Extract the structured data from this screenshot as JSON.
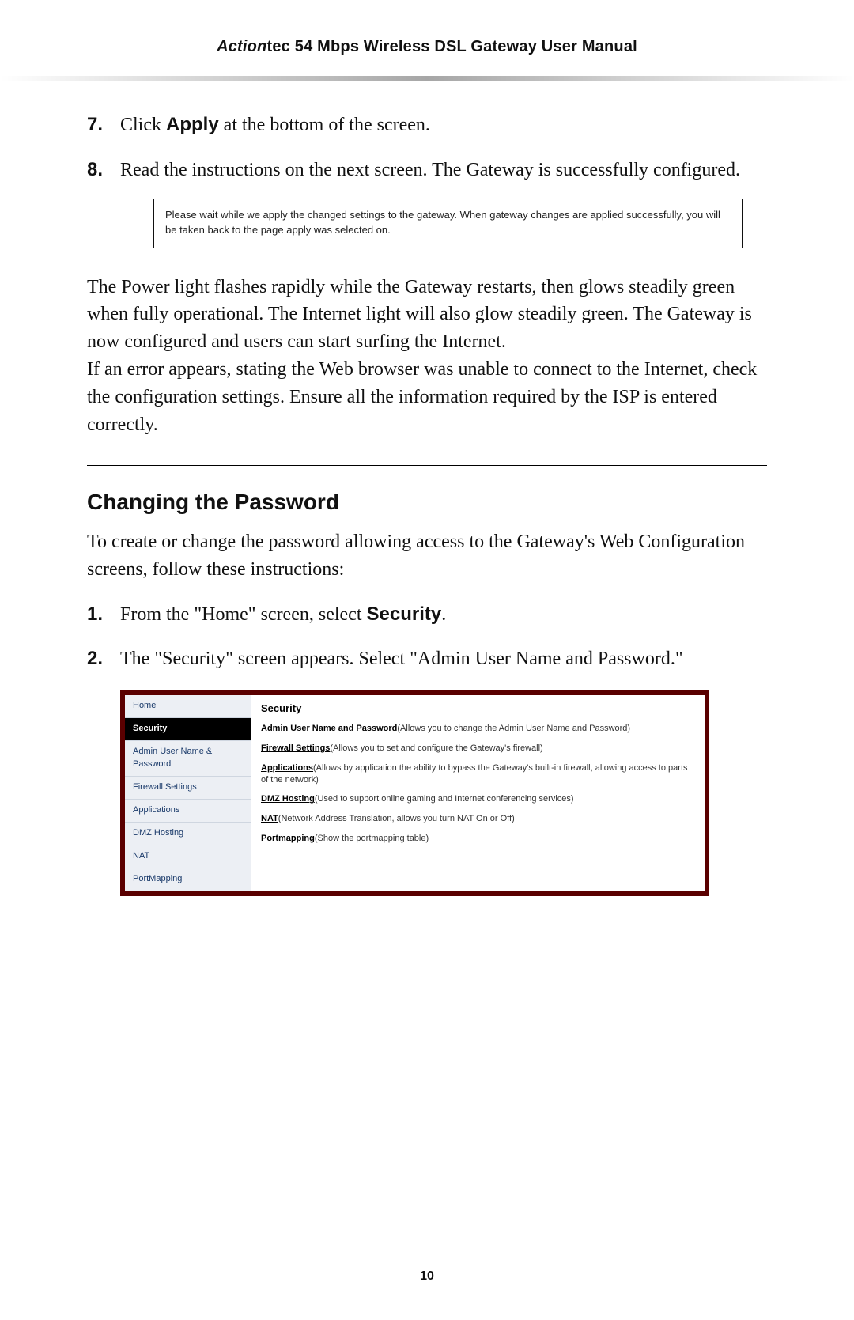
{
  "header": {
    "brand_ital": "Action",
    "brand_rest": "tec 54 Mbps Wireless DSL Gateway User Manual"
  },
  "steps_top": [
    {
      "num": "7.",
      "pre": "Click ",
      "bold": "Apply",
      "post": " at the bottom of the screen."
    },
    {
      "num": "8.",
      "pre": "Read the instructions on the next screen. The Gateway is successfully configured.",
      "bold": "",
      "post": ""
    }
  ],
  "msg_box": "Please wait while we apply the changed settings to the gateway. When gateway changes are applied successfully, you will be taken back to the page apply was selected on.",
  "para1": "The Power light flashes rapidly while the Gateway restarts, then glows steadily green when fully operational. The Internet light will also glow steadily green. The Gateway is now configured and users can start surfing the Internet.",
  "para2": "If an error appears, stating the Web browser was unable to connect to the Internet, check the configuration settings. Ensure all the information required by the ISP is entered correctly.",
  "section_title": "Changing the Password",
  "section_intro": "To create or change the password allowing access to the Gateway's Web Configuration screens, follow these instructions:",
  "steps_section": [
    {
      "num": "1.",
      "pre": "From the \"Home\" screen, select ",
      "bold": "Security",
      "post": "."
    },
    {
      "num": "2.",
      "pre": "The \"Security\" screen appears. Select \"Admin User Name and Password.\"",
      "bold": "",
      "post": ""
    }
  ],
  "screenshot": {
    "sidebar": [
      {
        "label": "Home",
        "sel": false
      },
      {
        "label": "Security",
        "sel": true
      },
      {
        "label": "Admin User Name & Password",
        "sel": false
      },
      {
        "label": "Firewall Settings",
        "sel": false
      },
      {
        "label": "Applications",
        "sel": false
      },
      {
        "label": "DMZ Hosting",
        "sel": false
      },
      {
        "label": "NAT",
        "sel": false
      },
      {
        "label": "PortMapping",
        "sel": false
      }
    ],
    "main_title": "Security",
    "entries": [
      {
        "link": "Admin User Name and Password",
        "desc": "(Allows you to change the Admin User Name and Password)"
      },
      {
        "link": "Firewall Settings",
        "desc": "(Allows you to set and configure the Gateway's firewall)"
      },
      {
        "link": "Applications",
        "desc": "(Allows by application the ability to bypass the Gateway's built-in firewall, allowing access to parts of the network)"
      },
      {
        "link": "DMZ Hosting",
        "desc": "(Used to support online gaming and Internet conferencing services)"
      },
      {
        "link": "NAT",
        "desc": "(Network Address Translation, allows you turn NAT On or Off)"
      },
      {
        "link": "Portmapping",
        "desc": "(Show the portmapping table)"
      }
    ]
  },
  "page_number": "10"
}
